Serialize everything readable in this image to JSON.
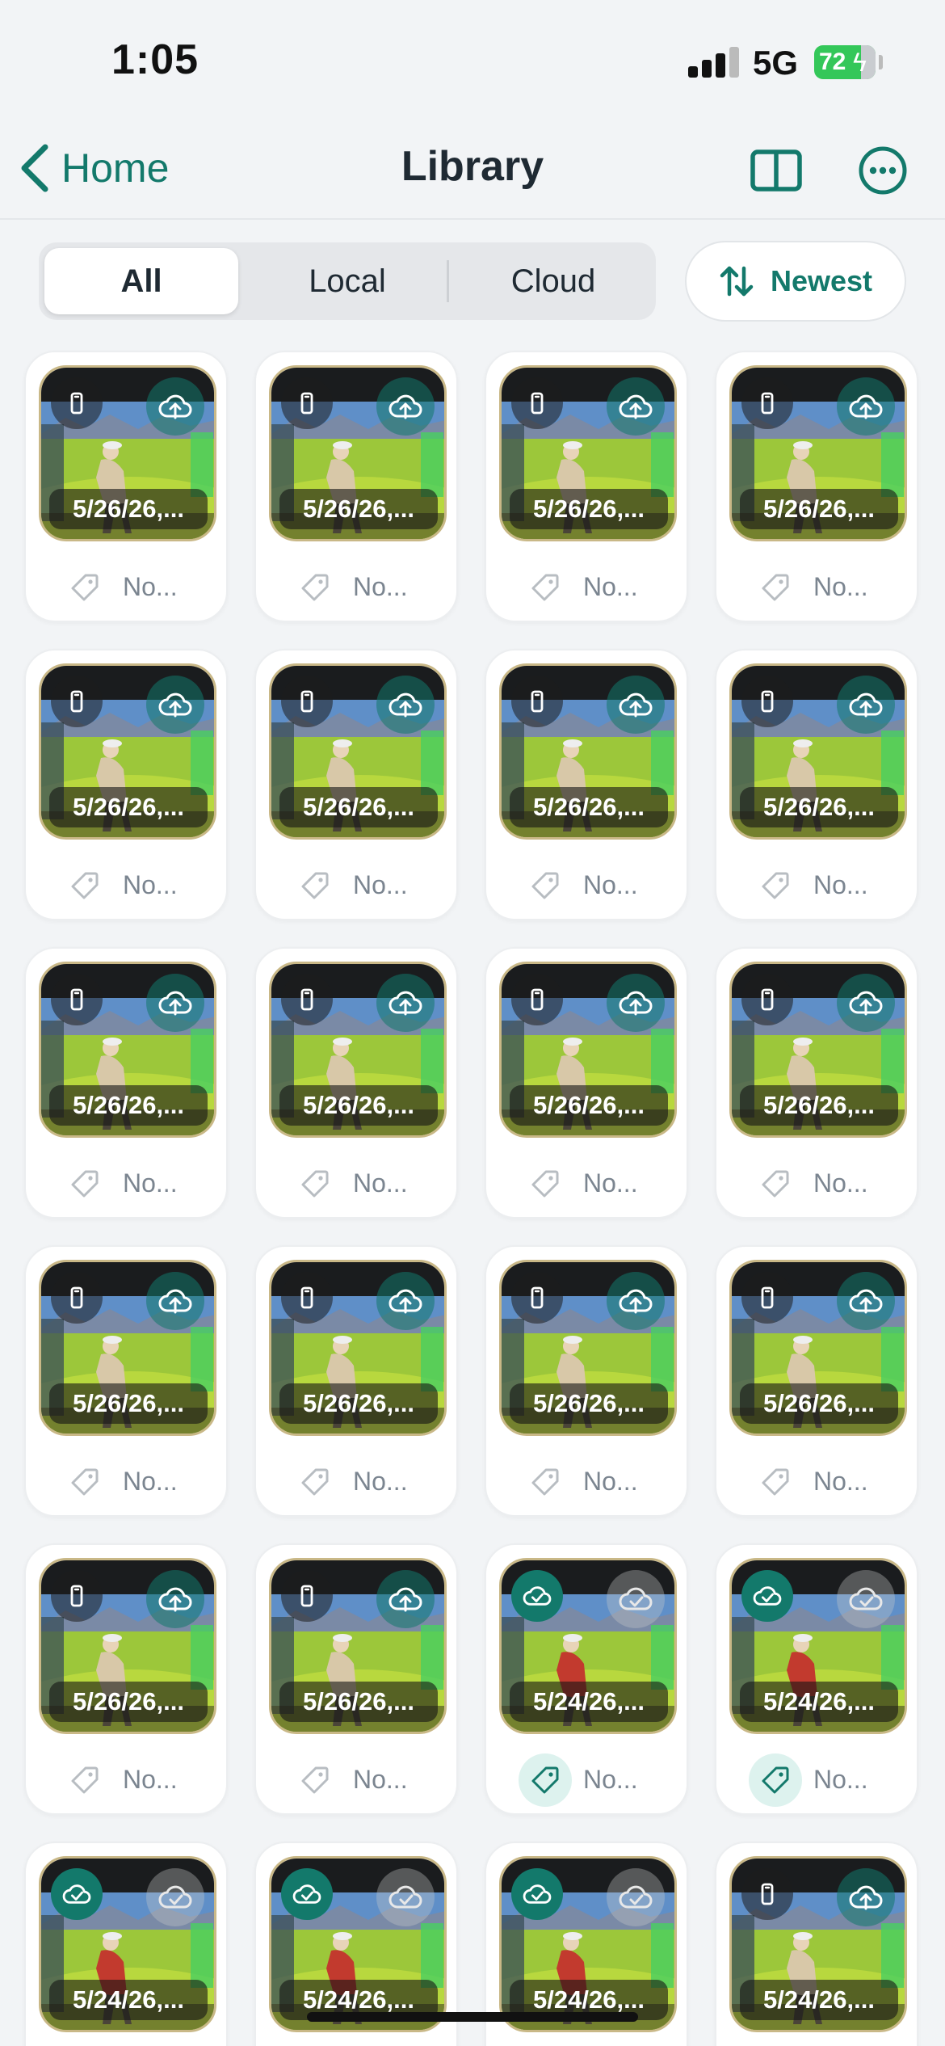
{
  "status_bar": {
    "time": "1:05",
    "network": "5G",
    "battery": "72"
  },
  "nav": {
    "back_label": "Home",
    "title": "Library"
  },
  "filter": {
    "tabs": [
      "All",
      "Local",
      "Cloud"
    ],
    "active": "All",
    "sort_label": "Newest"
  },
  "colors": {
    "accent": "#13796b",
    "background": "#f2f4f6",
    "card": "#ffffff"
  },
  "clips": [
    {
      "date": "5/26/26,...",
      "note": "No...",
      "status": "local"
    },
    {
      "date": "5/26/26,...",
      "note": "No...",
      "status": "local"
    },
    {
      "date": "5/26/26,...",
      "note": "No...",
      "status": "local"
    },
    {
      "date": "5/26/26,...",
      "note": "No...",
      "status": "local"
    },
    {
      "date": "5/26/26,...",
      "note": "No...",
      "status": "local"
    },
    {
      "date": "5/26/26,...",
      "note": "No...",
      "status": "local"
    },
    {
      "date": "5/26/26,...",
      "note": "No...",
      "status": "local"
    },
    {
      "date": "5/26/26,...",
      "note": "No...",
      "status": "local"
    },
    {
      "date": "5/26/26,...",
      "note": "No...",
      "status": "local"
    },
    {
      "date": "5/26/26,...",
      "note": "No...",
      "status": "local"
    },
    {
      "date": "5/26/26,...",
      "note": "No...",
      "status": "local"
    },
    {
      "date": "5/26/26,...",
      "note": "No...",
      "status": "local"
    },
    {
      "date": "5/26/26,...",
      "note": "No...",
      "status": "local"
    },
    {
      "date": "5/26/26,...",
      "note": "No...",
      "status": "local"
    },
    {
      "date": "5/26/26,...",
      "note": "No...",
      "status": "local"
    },
    {
      "date": "5/26/26,...",
      "note": "No...",
      "status": "local"
    },
    {
      "date": "5/26/26,...",
      "note": "No...",
      "status": "local"
    },
    {
      "date": "5/26/26,...",
      "note": "No...",
      "status": "local"
    },
    {
      "date": "5/24/26,...",
      "note": "No...",
      "status": "synced"
    },
    {
      "date": "5/24/26,...",
      "note": "No...",
      "status": "synced"
    },
    {
      "date": "5/24/26,...",
      "note": "",
      "status": "synced"
    },
    {
      "date": "5/24/26,...",
      "note": "",
      "status": "synced"
    },
    {
      "date": "5/24/26,...",
      "note": "",
      "status": "synced"
    },
    {
      "date": "5/24/26,...",
      "note": "",
      "status": "local"
    }
  ]
}
